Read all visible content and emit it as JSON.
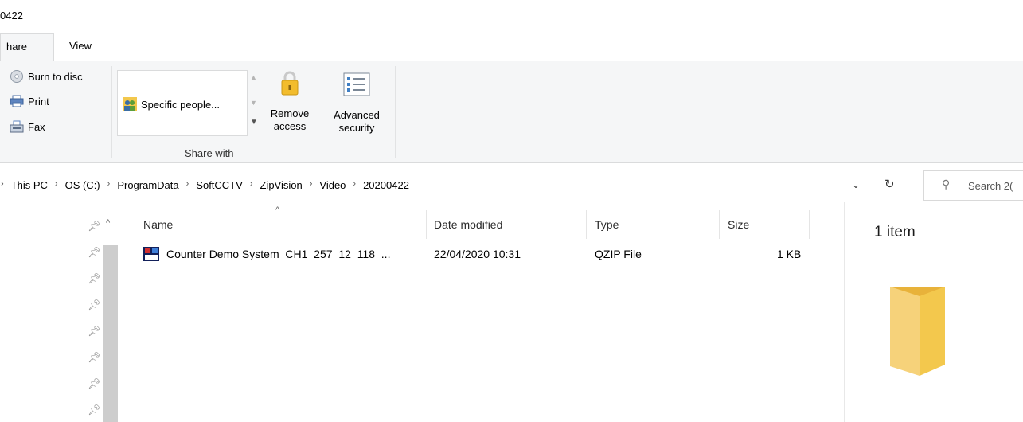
{
  "window": {
    "title": "0422"
  },
  "ribbon_tabs": [
    {
      "label": "hare",
      "active": true
    },
    {
      "label": "View",
      "active": false
    }
  ],
  "ribbon": {
    "send": [
      {
        "label": "Burn to disc",
        "icon": "disc-icon"
      },
      {
        "label": "Print",
        "icon": "printer-icon"
      },
      {
        "label": "Fax",
        "icon": "fax-icon"
      }
    ],
    "share_with": {
      "gallery_item": "Specific people...",
      "group_label": "Share with"
    },
    "remove_access": {
      "line1": "Remove",
      "line2": "access"
    },
    "advanced_security": {
      "line1": "Advanced",
      "line2": "security"
    }
  },
  "address": {
    "breadcrumbs": [
      "This PC",
      "OS (C:)",
      "ProgramData",
      "SoftCCTV",
      "ZipVision",
      "Video",
      "20200422"
    ],
    "search_placeholder": "Search 2("
  },
  "columns": {
    "name": "Name",
    "date": "Date modified",
    "type": "Type",
    "size": "Size"
  },
  "files": [
    {
      "name": "Counter Demo System_CH1_257_12_118_...",
      "date": "22/04/2020 10:31",
      "type": "QZIP File",
      "size": "1 KB"
    }
  ],
  "preview": {
    "count_text": "1 item"
  },
  "colors": {
    "folder": "#f3c84d",
    "ribbon_bg": "#f5f6f7",
    "accent": "#0063b1"
  }
}
